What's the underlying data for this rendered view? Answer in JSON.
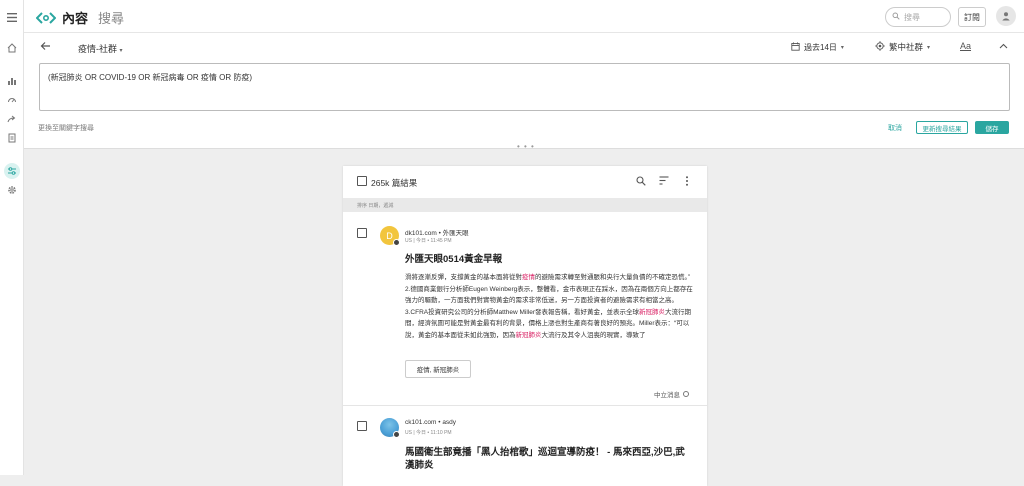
{
  "app": {
    "title": "內容",
    "subtitle": "搜尋",
    "search_placeholder": "搜尋",
    "subscribe_label": "訂閱"
  },
  "query": {
    "title": "疫情-社群",
    "date_range": "過去14日",
    "region": "繁中社群",
    "font_label": "Aa",
    "text": "(新冠肺炎 OR COVID-19 OR 新冠病毒 OR 疫情 OR 防疫)",
    "switch_label": "更換至關鍵字搜尋",
    "cancel_label": "取消",
    "update_label": "更新搜尋結果",
    "save_label": "儲存"
  },
  "results": {
    "count_label": "265k 篇結果",
    "sort_label": "排序 日期，遞減",
    "posts": [
      {
        "source": "dk101.com • 外匯天眼",
        "meta": "US | 今日 • 11:45 PM",
        "avatar_color": "#f2c53d",
        "avatar_letter": "D",
        "title": "外匯天眼0514黃金早報",
        "body_segments": [
          {
            "t": "滑將逐漸反彈，支撐黃金的基本面將從對",
            "h": false
          },
          {
            "t": "疫情",
            "h": true
          },
          {
            "t": "的避險需求轉至對通脹和央行大量負債的不確定恐慌。” 2.德國商業銀行分析師Eugen Weinberg表示，整體看，金市表現正在踩水，因為在兩個方向上都存在強力的驅動，一方面我們對實物黃金的需求非常低迷，另一方面投資者的避險需求有相當之高。 3.CFRA投資研究公司的分析師Matthew Miller發表報告稱，看好黃金，並表示全球",
            "h": false
          },
          {
            "t": "新冠肺炎",
            "h": true
          },
          {
            "t": "大流行期間，經濟氛圍可能是對黃金最有利的背景，價格上漲也對生產商有著良好的預兆。Miller表示：“可以說，黃金的基本面從未如此強勁，因為",
            "h": false
          },
          {
            "t": "新冠肺炎",
            "h": true
          },
          {
            "t": "大流行及其令人沮喪的現實，導致了",
            "h": false
          }
        ],
        "tag": "疫情, 新冠肺炎",
        "sentiment": "中立消息"
      },
      {
        "source": "ck101.com • asdy",
        "meta": "US | 今日 • 11:10 PM",
        "avatar_color": "#4a9fd6",
        "avatar_letter": "",
        "title": "馬國衛生部竟播「黑人抬棺歌」巡迴宣導防疫！ - 馬來西亞,沙巴,武漢肺炎",
        "body_segments": [],
        "tag": "",
        "sentiment": ""
      }
    ]
  }
}
